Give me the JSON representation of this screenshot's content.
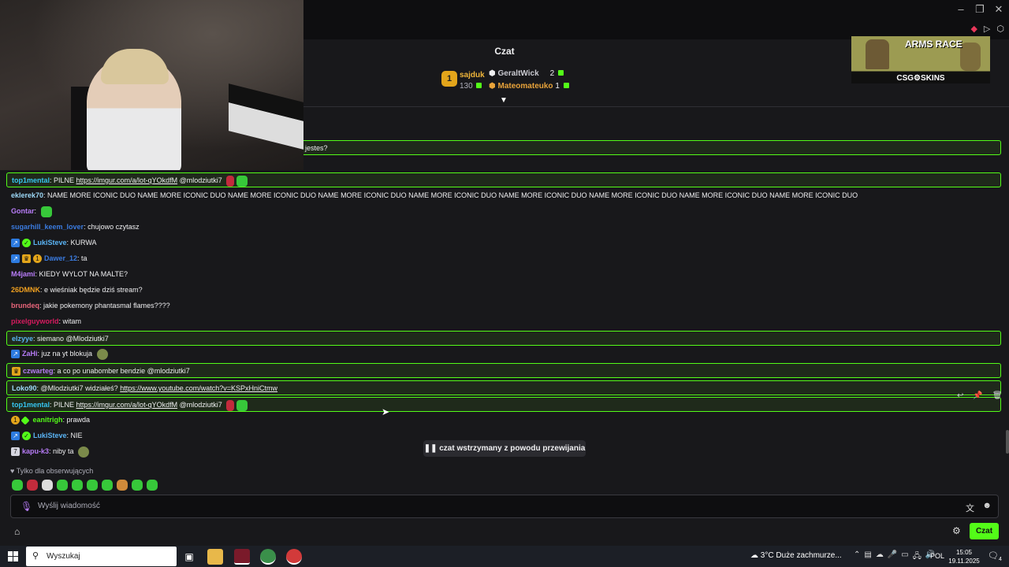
{
  "colors": {
    "accent": "#53fc18",
    "bg": "#18181b"
  },
  "chat": {
    "title": "Czat",
    "leaderboard": {
      "first": {
        "rank": "1",
        "name": "sajduk",
        "points": "130"
      },
      "second": {
        "name": "GeraltWick",
        "count": "2"
      },
      "third": {
        "name": "Mateomateuko",
        "count": "1"
      }
    },
    "ad": {
      "headline": "ARMS RACE",
      "brand": "CSG⚙SKINS"
    },
    "partial_message": "jestes?",
    "messages": [
      {
        "user": "top1mental",
        "color": "#36c5f0",
        "text": ": PILNE ",
        "link": "https://imgur.com/a/lot-qYOkdfM",
        "after": " @mlodziutki7",
        "highlight": true
      },
      {
        "user": "eklerek70",
        "color": "#9dd9f8",
        "text": ": NAME MORE ICONIC DUO NAME MORE ICONIC DUO NAME MORE ICONIC DUO NAME MORE ICONIC DUO NAME MORE ICONIC DUO NAME MORE ICONIC DUO NAME MORE ICONIC DUO NAME MORE ICONIC DUO NAME MORE ICONIC DUO"
      },
      {
        "user": "Gontar",
        "color": "#b77cf7",
        "text": ":"
      },
      {
        "user": "sugarhill_keem_lover",
        "color": "#3a7be0",
        "text": ": chujowo czytasz"
      },
      {
        "user": "LukiSteve",
        "color": "#5ab4f5",
        "text": ": KURWA"
      },
      {
        "user": "Dawer_12",
        "color": "#3a7be0",
        "text": ": ta"
      },
      {
        "user": "M4jami",
        "color": "#b77cf7",
        "text": ": KIEDY WYLOT NA MALTE?"
      },
      {
        "user": "26DMNK",
        "color": "#f0a020",
        "text": ": e wieśniak będzie dziś stream?"
      },
      {
        "user": "brundeq",
        "color": "#e8657a",
        "text": ": jakie pokemony phantasmal flames????"
      },
      {
        "user": "pixelguyworld",
        "color": "#d81b60",
        "text": ": witam"
      },
      {
        "user": "elzyye",
        "color": "#5ab4f5",
        "text": ": siemano @Mlodziutki7",
        "highlight": true
      },
      {
        "user": "ZaHi",
        "color": "#b77cf7",
        "text": ": juz na yt blokuja"
      },
      {
        "user": "czwarteg",
        "color": "#b77cf7",
        "text": ": a co po unabomber bendzie @mlodziutki7",
        "highlight": true
      },
      {
        "user": "Loko90",
        "color": "#9dd9f8",
        "text": ": @Mlodziutki7 widziałeś? ",
        "link": "https://www.youtube.com/watch?v=KSPxHniCtmw",
        "highlight": true
      },
      {
        "user": "top1mental",
        "color": "#36c5f0",
        "text": ": PILNE ",
        "link": "https://imgur.com/a/lot-qYOkdfM",
        "after": " @mlodziutki7",
        "highlight": true
      },
      {
        "user": "eanitrigh",
        "color": "#53fc18",
        "text": ": prawda"
      },
      {
        "user": "LukiSteve",
        "color": "#5ab4f5",
        "text": ": NIE"
      },
      {
        "user": "kapu-k3",
        "color": "#b77cf7",
        "text": ": niby ta"
      }
    ],
    "paused_text": "czat wstrzymany z powodu przewijania",
    "followers_only": "Tylko dla obserwujących",
    "input_placeholder": "Wyślij wiadomość",
    "send_button": "Czat"
  },
  "taskbar": {
    "search_placeholder": "Wyszukaj",
    "weather": "3°C  Duże zachmurze...",
    "language": "POL",
    "time": "15:05",
    "date": "19.11.2025",
    "notifications": "4"
  }
}
